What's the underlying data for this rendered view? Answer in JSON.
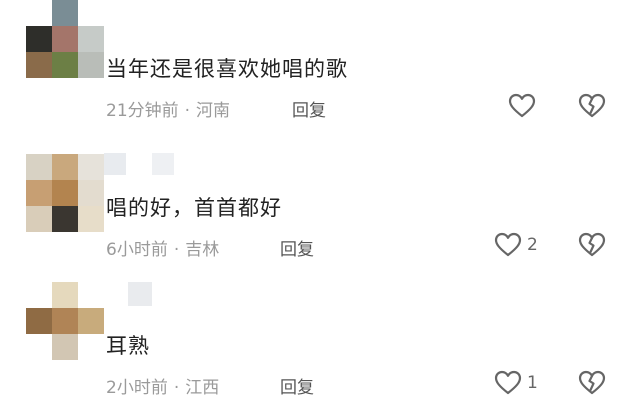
{
  "comments": [
    {
      "text": "当年还是很喜欢她唱的歌",
      "time": "21分钟前",
      "location": "河南",
      "reply_label": "回复",
      "like_count": ""
    },
    {
      "text": "唱的好，首首都好",
      "time": "6小时前",
      "location": "吉林",
      "reply_label": "回复",
      "like_count": "2"
    },
    {
      "text": "耳熟",
      "time": "2小时前",
      "location": "江西",
      "reply_label": "回复",
      "like_count": "1"
    }
  ],
  "meta_separator": "·",
  "icons": {
    "like": "heart-outline-icon",
    "dislike": "broken-heart-icon"
  },
  "colors": {
    "text": "#222222",
    "meta": "#9a9a9a",
    "icon": "#666666"
  }
}
